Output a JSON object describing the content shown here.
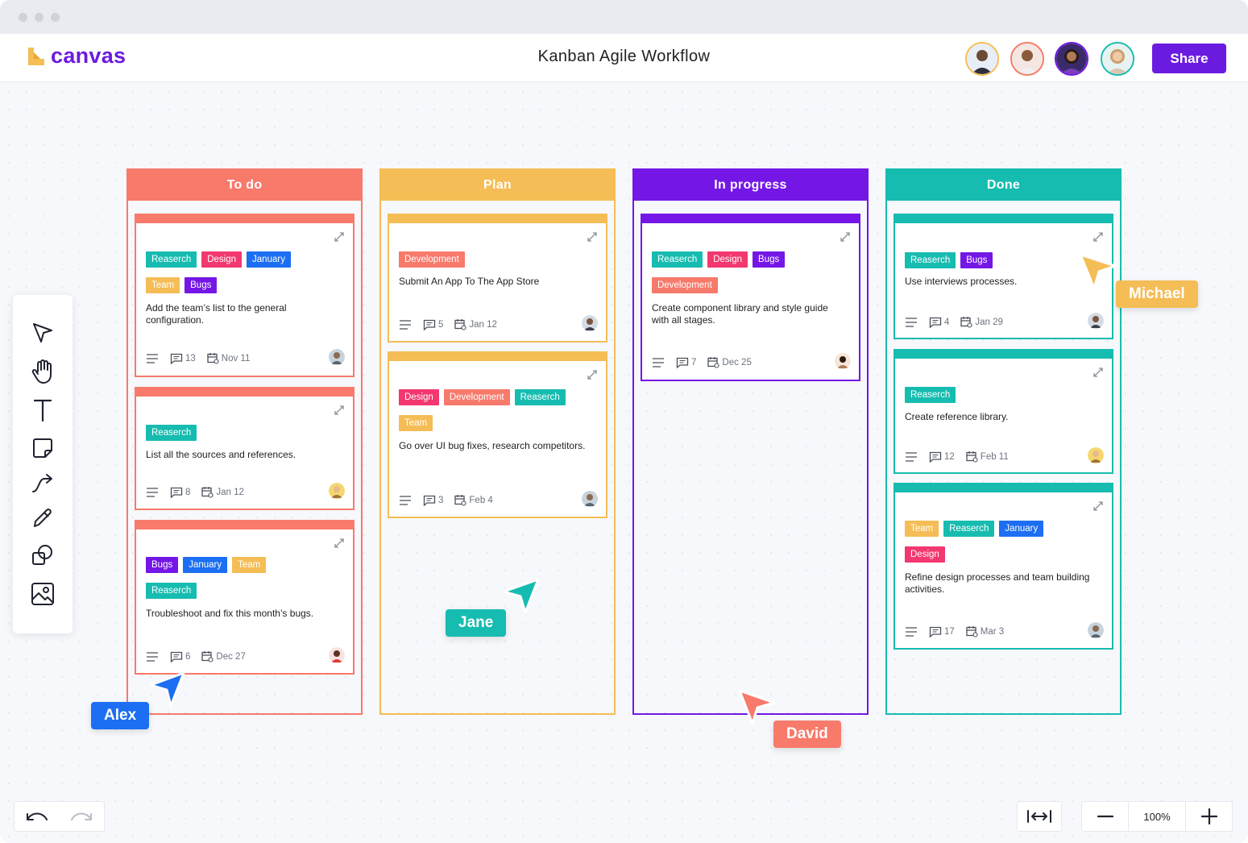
{
  "app": {
    "logo_text": "canvas",
    "document_title": "Kanban Agile Workflow",
    "share_label": "Share"
  },
  "colors": {
    "brand": "#6b1be0",
    "todo": "#f77a6b",
    "plan": "#f5bd55",
    "in_progress": "#7417e6",
    "done": "#17bcb0",
    "tag_research": "#17bcb0",
    "tag_design": "#f2386f",
    "tag_january": "#1c6ef2",
    "tag_team": "#f5bd55",
    "tag_bugs": "#7417e6",
    "tag_development": "#f77a6b"
  },
  "columns": [
    {
      "title": "To do"
    },
    {
      "title": "Plan"
    },
    {
      "title": "In progress"
    },
    {
      "title": "Done"
    }
  ],
  "cards": {
    "todo_1": {
      "tags_row1": [
        "Reaserch",
        "Design",
        "January"
      ],
      "tags_row2": [
        "Team",
        "Bugs"
      ],
      "text": "Add the team’s list to the general configuration.",
      "comments": "13",
      "date": "Nov 11"
    },
    "todo_2": {
      "tags_row1": [
        "Reaserch"
      ],
      "text": "List all the sources and references.",
      "comments": "8",
      "date": "Jan 12"
    },
    "todo_3": {
      "tags_row1": [
        "Bugs",
        "January",
        "Team"
      ],
      "tags_row2": [
        "Reaserch"
      ],
      "text": "Troubleshoot and fix this month’s bugs.",
      "comments": "6",
      "date": "Dec 27"
    },
    "plan_1": {
      "tags_row1": [
        "Development"
      ],
      "text": "Submit An App To The App Store",
      "comments": "5",
      "date": "Jan 12"
    },
    "plan_2": {
      "tags_row1": [
        "Design",
        "Development",
        "Reaserch"
      ],
      "tags_row2": [
        "Team"
      ],
      "text": "Go over UI bug fixes, research competitors.",
      "comments": "3",
      "date": "Feb 4"
    },
    "prog_1": {
      "tags_row1": [
        "Reaserch",
        "Design",
        "Bugs"
      ],
      "tags_row2": [
        "Development"
      ],
      "text": "Create component library and style guide with all stages.",
      "comments": "7",
      "date": "Dec 25"
    },
    "done_1": {
      "tags_row1": [
        "Reaserch",
        "Bugs"
      ],
      "text": "Use interviews processes.",
      "comments": "4",
      "date": "Jan 29"
    },
    "done_2": {
      "tags_row1": [
        "Reaserch"
      ],
      "text": "Create reference library.",
      "comments": "12",
      "date": "Feb 11"
    },
    "done_3": {
      "tags_row1": [
        "Team",
        "Reaserch",
        "January"
      ],
      "tags_row2": [
        "Design"
      ],
      "text": "Refine design processes and team building activities.",
      "comments": "17",
      "date": "Mar 3"
    }
  },
  "cursors": {
    "alex": "Alex",
    "jane": "Jane",
    "david": "David",
    "michael": "Michael"
  },
  "zoom": {
    "level": "100%"
  }
}
